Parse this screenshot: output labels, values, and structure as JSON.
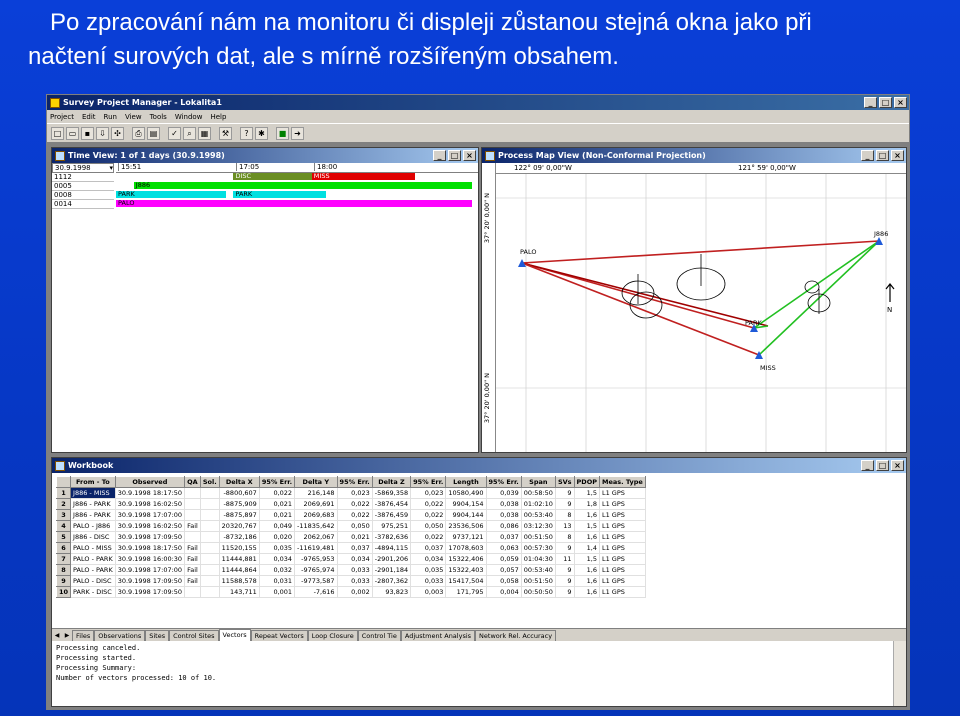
{
  "slide": {
    "title_line1": "Po zpracování nám na monitoru či displeji zůstanou stejná okna jako při",
    "title_line2": "načtení surových dat, ale s mírně rozšířeným obsahem."
  },
  "app": {
    "title": "Survey Project Manager - Lokalita1",
    "menu": [
      "Project",
      "Edit",
      "Run",
      "View",
      "Tools",
      "Window",
      "Help"
    ],
    "toolbar_icons": [
      "new-icon",
      "open-icon",
      "save-icon",
      "import-icon",
      "network-icon",
      "gap",
      "print-icon",
      "preview-icon",
      "gap",
      "check-icon",
      "zoom-icon",
      "grid-icon",
      "gap",
      "tool-icon",
      "gap",
      "help-icon",
      "bulb-icon",
      "gap",
      "green-box-icon",
      "arrow-icon"
    ]
  },
  "time_view": {
    "title": "Time View: 1 of 1 days (30.9.1998)",
    "date": "30.9.1998",
    "times": [
      "15:51",
      "17:05",
      "18:00"
    ],
    "stations": [
      "1112",
      "0005",
      "0008",
      "0014"
    ],
    "bars": [
      {
        "label": "DISC",
        "row": 0,
        "start": 0.33,
        "end": 0.55,
        "color": "#6b8e23"
      },
      {
        "label": "MISS",
        "row": 0,
        "start": 0.55,
        "end": 0.84,
        "color": "#e00000"
      },
      {
        "label": "J886",
        "row": 1,
        "start": 0.05,
        "end": 1.0,
        "color": "#00e000"
      },
      {
        "label": "PARK",
        "row": 2,
        "start": 0.0,
        "end": 0.31,
        "color": "#00e0e0"
      },
      {
        "label": "PARK",
        "row": 2,
        "start": 0.33,
        "end": 0.59,
        "color": "#00e0e0"
      },
      {
        "label": "PALO",
        "row": 3,
        "start": 0.0,
        "end": 1.0,
        "color": "#ff00ff"
      }
    ]
  },
  "map_view": {
    "title": "Process Map View (Non-Conformal Projection)",
    "lon_left": "122° 09' 0,00\"W",
    "lon_right": "121° 59' 0,00\"W",
    "lat_top": "37° 20' 0,00\" N",
    "lat_bottom": "37° 20' 0,00\" N",
    "north": "N",
    "points": [
      "PALO",
      "J886",
      "PARK",
      "MISS"
    ]
  },
  "workbook": {
    "title": "Workbook",
    "columns": [
      "",
      "From - To",
      "Observed",
      "QA",
      "Sol.",
      "Delta X",
      "95% Err.",
      "Delta Y",
      "95% Err.",
      "Delta Z",
      "95% Err.",
      "Length",
      "95% Err.",
      "Span",
      "SVs",
      "PDOP",
      "Meas. Type"
    ],
    "rows": [
      [
        "1",
        "J886 - MISS",
        "30.9.1998 18:17:50",
        "",
        "",
        "-8800,607",
        "0,022",
        "216,148",
        "0,023",
        "-5869,358",
        "0,023",
        "10580,490",
        "0,039",
        "00:58:50",
        "9",
        "1,5",
        "L1 GPS"
      ],
      [
        "2",
        "J886 - PARK",
        "30.9.1998 16:02:50",
        "",
        "",
        "-8875,909",
        "0,021",
        "2069,691",
        "0,022",
        "-3876,454",
        "0,022",
        "9904,154",
        "0,038",
        "01:02:10",
        "9",
        "1,8",
        "L1 GPS"
      ],
      [
        "3",
        "J886 - PARK",
        "30.9.1998 17:07:00",
        "",
        "",
        "-8875,897",
        "0,021",
        "2069,683",
        "0,022",
        "-3876,459",
        "0,022",
        "9904,144",
        "0,038",
        "00:53:40",
        "8",
        "1,6",
        "L1 GPS"
      ],
      [
        "4",
        "PALO - J886",
        "30.9.1998 16:02:50",
        "Fail",
        "",
        "20320,767",
        "0,049",
        "-11835,642",
        "0,050",
        "975,251",
        "0,050",
        "23536,506",
        "0,086",
        "03:12:30",
        "13",
        "1,5",
        "L1 GPS"
      ],
      [
        "5",
        "J886 - DISC",
        "30.9.1998 17:09:50",
        "",
        "",
        "-8732,186",
        "0,020",
        "2062,067",
        "0,021",
        "-3782,636",
        "0,022",
        "9737,121",
        "0,037",
        "00:51:50",
        "8",
        "1,6",
        "L1 GPS"
      ],
      [
        "6",
        "PALO - MISS",
        "30.9.1998 18:17:50",
        "Fail",
        "",
        "11520,155",
        "0,035",
        "-11619,481",
        "0,037",
        "-4894,115",
        "0,037",
        "17078,603",
        "0,063",
        "00:57:30",
        "9",
        "1,4",
        "L1 GPS"
      ],
      [
        "7",
        "PALO - PARK",
        "30.9.1998 16:00:30",
        "Fail",
        "",
        "11444,881",
        "0,034",
        "-9765,953",
        "0,034",
        "-2901,206",
        "0,034",
        "15322,406",
        "0,059",
        "01:04:30",
        "11",
        "1,5",
        "L1 GPS"
      ],
      [
        "8",
        "PALO - PARK",
        "30.9.1998 17:07:00",
        "Fail",
        "",
        "11444,864",
        "0,032",
        "-9765,974",
        "0,033",
        "-2901,184",
        "0,035",
        "15322,403",
        "0,057",
        "00:53:40",
        "9",
        "1,6",
        "L1 GPS"
      ],
      [
        "9",
        "PALO - DISC",
        "30.9.1998 17:09:50",
        "Fail",
        "",
        "11588,578",
        "0,031",
        "-9773,587",
        "0,033",
        "-2807,362",
        "0,033",
        "15417,504",
        "0,058",
        "00:51:50",
        "9",
        "1,6",
        "L1 GPS"
      ],
      [
        "10",
        "PARK - DISC",
        "30.9.1998 17:09:50",
        "",
        "",
        "143,711",
        "0,001",
        "-7,616",
        "0,002",
        "93,823",
        "0,003",
        "171,795",
        "0,004",
        "00:50:50",
        "9",
        "1,6",
        "L1 GPS"
      ]
    ],
    "tabs": [
      "Files",
      "Observations",
      "Sites",
      "Control Sites",
      "Vectors",
      "Repeat Vectors",
      "Loop Closure",
      "Control Tie",
      "Adjustment Analysis",
      "Network Rel. Accuracy"
    ],
    "active_tab": "Vectors",
    "log": [
      "Processing canceled.",
      "Processing started.",
      "Processing Summary:",
      "Number of vectors processed: 10 of 10."
    ]
  }
}
